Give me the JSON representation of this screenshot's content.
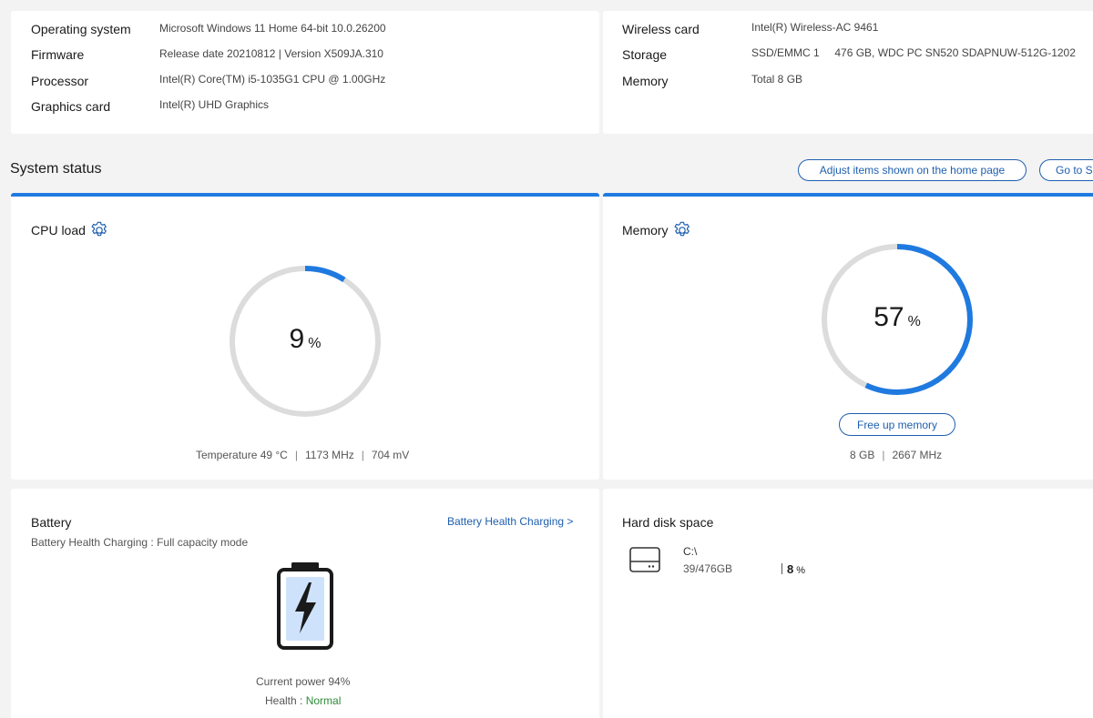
{
  "specs_left": [
    {
      "label": "Operating system",
      "value": "Microsoft Windows 11 Home 64-bit 10.0.26200"
    },
    {
      "label": "Firmware",
      "value": "Release date 20210812 | Version X509JA.310"
    },
    {
      "label": "Processor",
      "value": "Intel(R) Core(TM) i5-1035G1 CPU @ 1.00GHz"
    },
    {
      "label": "Graphics card",
      "value": "Intel(R) UHD Graphics"
    }
  ],
  "specs_right": [
    {
      "label": "Wireless card",
      "value": "Intel(R) Wireless-AC 9461"
    },
    {
      "label": "Storage",
      "value": "SSD/EMMC 1     476 GB, WDC PC SN520 SDAPNUW-512G-1202"
    },
    {
      "label": "Memory",
      "value": "Total 8 GB"
    }
  ],
  "section": {
    "title": "System status",
    "adjust_label": "Adjust items shown on the home page",
    "goto_label": "Go to S"
  },
  "cpu": {
    "title": "CPU load",
    "value": "9",
    "percent": 9,
    "unit": "%",
    "temperature": "Temperature 49 °C",
    "frequency": "1173 MHz",
    "voltage": "704 mV"
  },
  "memory": {
    "title": "Memory",
    "value": "57",
    "percent": 57,
    "unit": "%",
    "free_label": "Free up memory",
    "size": "8 GB",
    "speed": "2667 MHz"
  },
  "battery": {
    "title": "Battery",
    "mode": "Battery Health Charging : Full capacity mode",
    "link": "Battery Health Charging >",
    "current_power": "Current power 94%",
    "health_label": "Health : ",
    "health_value": "Normal"
  },
  "disk": {
    "title": "Hard disk space",
    "drive": "C:\\",
    "usage": "39/476GB",
    "percent_value": "8",
    "percent_unit": "%",
    "percent": 8
  },
  "colors": {
    "accent": "#1f7ae0",
    "track": "#dcdcdc",
    "link": "#1f5fae",
    "health_ok": "#2e8b3a"
  }
}
